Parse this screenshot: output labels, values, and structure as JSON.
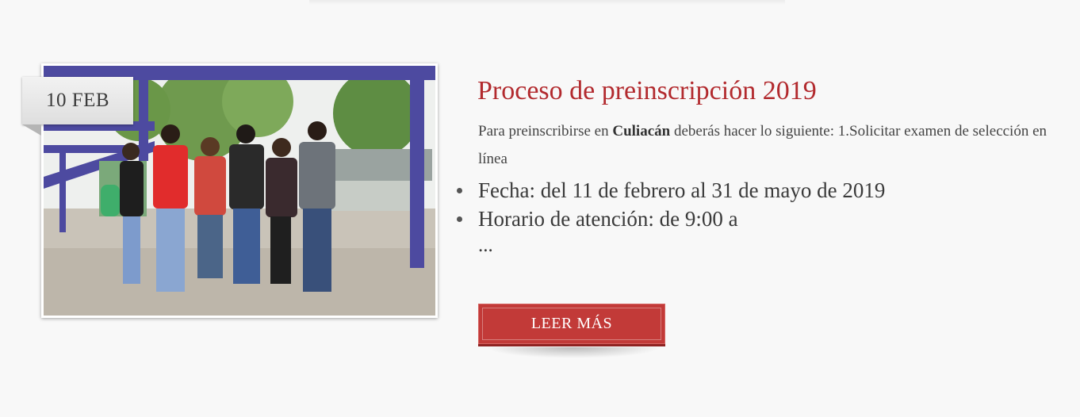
{
  "post": {
    "date": "10 FEB",
    "title": "Proceso de preinscripción 2019",
    "excerpt_before": "Para preinscribirse en ",
    "excerpt_bold": "Culiacán",
    "excerpt_after": " deberás hacer lo siguiente: 1.Solicitar examen de selección en línea",
    "bullets": [
      "Fecha: del 11 de febrero al 31 de mayo de 2019",
      "Horario de atención: de 9:00 a"
    ],
    "ellipsis": "...",
    "read_more_label": "LEER MÁS"
  },
  "colors": {
    "background": "#f8f8f8",
    "title": "#b22a2e",
    "button": "#c23a38"
  }
}
